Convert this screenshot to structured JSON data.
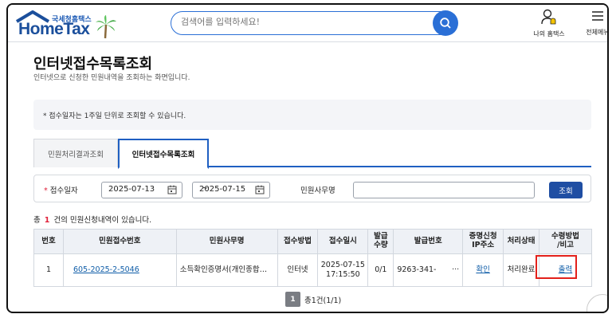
{
  "header": {
    "logo_sub": "국세청홈택스",
    "logo_main": "HomeTax",
    "search_placeholder": "검색어를 입력하세요!",
    "my_hometax_label": "나의 홈택스",
    "menu_all_label": "전체메뉴"
  },
  "page": {
    "title": "인터넷접수목록조회",
    "description": "인터넷으로 신청한 민원내역을 조회하는 화면입니다.",
    "notice": "* 접수일자는 1주일 단위로 조회할 수 있습니다."
  },
  "tabs": [
    "민원처리결과조회",
    "인터넷접수목록조회"
  ],
  "filter": {
    "date_label": "접수일자",
    "required_mark": "*",
    "date_from": "2025-07-13",
    "tilde": "~",
    "date_to": "2025-07-15",
    "office_label": "민원사무명",
    "office_value": "",
    "query_button": "조회"
  },
  "count": {
    "prefix": "총",
    "value": "1",
    "suffix": "건의 민원신청내역이 있습니다."
  },
  "table": {
    "headers": [
      "번호",
      "민원접수번호",
      "민원사무명",
      "접수방법",
      "접수일시",
      "발급\n수량",
      "발급번호",
      "증명신청\nIP주소",
      "처리상태",
      "수령방법\n/비고"
    ],
    "rows": [
      {
        "no": "1",
        "receipt_no": "605-2025-2-5046",
        "office": "소득확인증명서(개인종합…",
        "method": "인터넷",
        "datetime_date": "2025-07-15",
        "datetime_time": "17:15:50",
        "qty": "0/1",
        "issue_no": "9263-341-",
        "issue_ellipsis": "···",
        "ip": "확인",
        "status": "처리완료",
        "receipt_method": "출력"
      }
    ]
  },
  "pager": {
    "current": "1",
    "summary": "총1건(1/1)"
  },
  "colors": {
    "brand": "#1b4f9c",
    "accent": "#2a6fd6",
    "required": "#e0203a",
    "highlight": "#e3201b"
  }
}
